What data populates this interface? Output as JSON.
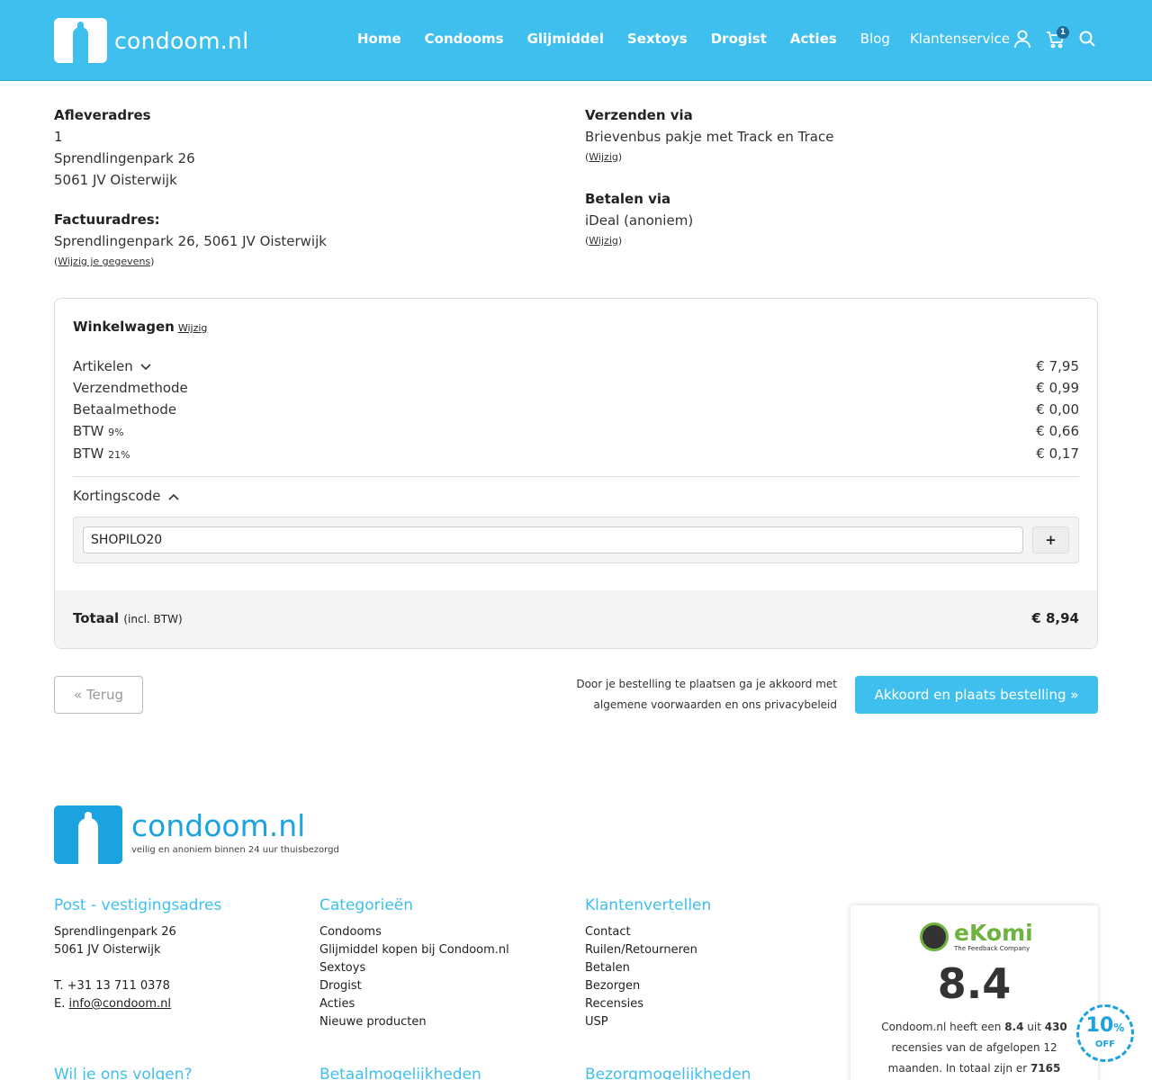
{
  "header": {
    "logo_text": "condoom.nl",
    "nav": [
      "Home",
      "Condooms",
      "Glijmiddel",
      "Sextoys",
      "Drogist",
      "Acties",
      "Blog",
      "Klantenservice"
    ],
    "cart_count": "1"
  },
  "delivery": {
    "title": "Afleveradres",
    "line1": "1",
    "line2": "Sprendlingenpark 26",
    "line3": "5061 JV Oisterwijk"
  },
  "invoice": {
    "title": "Factuuradres:",
    "line": "Sprendlingenpark 26, 5061 JV Oisterwijk",
    "edit": "Wijzig je gegevens"
  },
  "shipping": {
    "title": "Verzenden via",
    "value": "Brievenbus pakje met Track en Trace",
    "edit": "Wijzig"
  },
  "payment": {
    "title": "Betalen via",
    "value": "iDeal (anoniem)",
    "edit": "Wijzig"
  },
  "cart": {
    "title": "Winkelwagen",
    "edit": "Wijzig",
    "rows": [
      {
        "label": "Artikelen",
        "suffix": "",
        "value": "€ 7,95"
      },
      {
        "label": "Verzendmethode",
        "suffix": "",
        "value": "€ 0,99"
      },
      {
        "label": "Betaalmethode",
        "suffix": "",
        "value": "€ 0,00"
      },
      {
        "label": "BTW",
        "suffix": "9%",
        "value": "€ 0,66"
      },
      {
        "label": "BTW",
        "suffix": "21%",
        "value": "€ 0,17"
      }
    ],
    "coupon_label": "Kortingscode",
    "coupon_value": "SHOPILO20",
    "coupon_button": "+",
    "total_label": "Totaal",
    "total_suffix": "(incl. BTW)",
    "total_value": "€ 8,94"
  },
  "actions": {
    "back": "« Terug",
    "terms_line1": "Door je bestelling te plaatsen ga je akkoord met",
    "terms_line2": "algemene voorwaarden en ons privacybeleid",
    "order": "Akkoord en plaats bestelling »"
  },
  "footer": {
    "logo_text": "condoom.nl",
    "tagline": "veilig en anoniem binnen 24 uur thuisbezorgd",
    "address": {
      "title": "Post - vestigingsadres",
      "line1": "Sprendlingenpark 26",
      "line2": "5061 JV Oisterwijk",
      "phone": "T. +31 13 711 0378",
      "email_prefix": "E.",
      "email": "info@condoom.nl"
    },
    "categories": {
      "title": "Categorieën",
      "items": [
        "Condooms",
        "Glijmiddel kopen bij Condoom.nl",
        "Sextoys",
        "Drogist",
        "Acties",
        "Nieuwe producten"
      ]
    },
    "service": {
      "title": "Klantenvertellen",
      "items": [
        "Contact",
        "Ruilen/Retourneren",
        "Betalen",
        "Bezorgen",
        "Recensies",
        "USP"
      ]
    },
    "bottom_titles": [
      "Wil je ons volgen?",
      "Betaalmogelijkheden",
      "Bezorgmogelijkheden"
    ]
  },
  "ekomi": {
    "name": "eKomi",
    "sub": "The Feedback Company",
    "score": "8.4",
    "text_a": "Condoom.nl heeft een ",
    "score_inline": "8.4",
    "text_b": " uit ",
    "count": "430",
    "text_c": " recensies van de afgelopen 12 maanden. In totaal zijn er ",
    "total": "7165"
  },
  "promo": {
    "percent": "10",
    "unit": "%",
    "off": "OFF"
  },
  "colors": {
    "brand": "#3fbfee",
    "footer_logo": "#1aa3e0",
    "ekomi": "#6db33f"
  }
}
